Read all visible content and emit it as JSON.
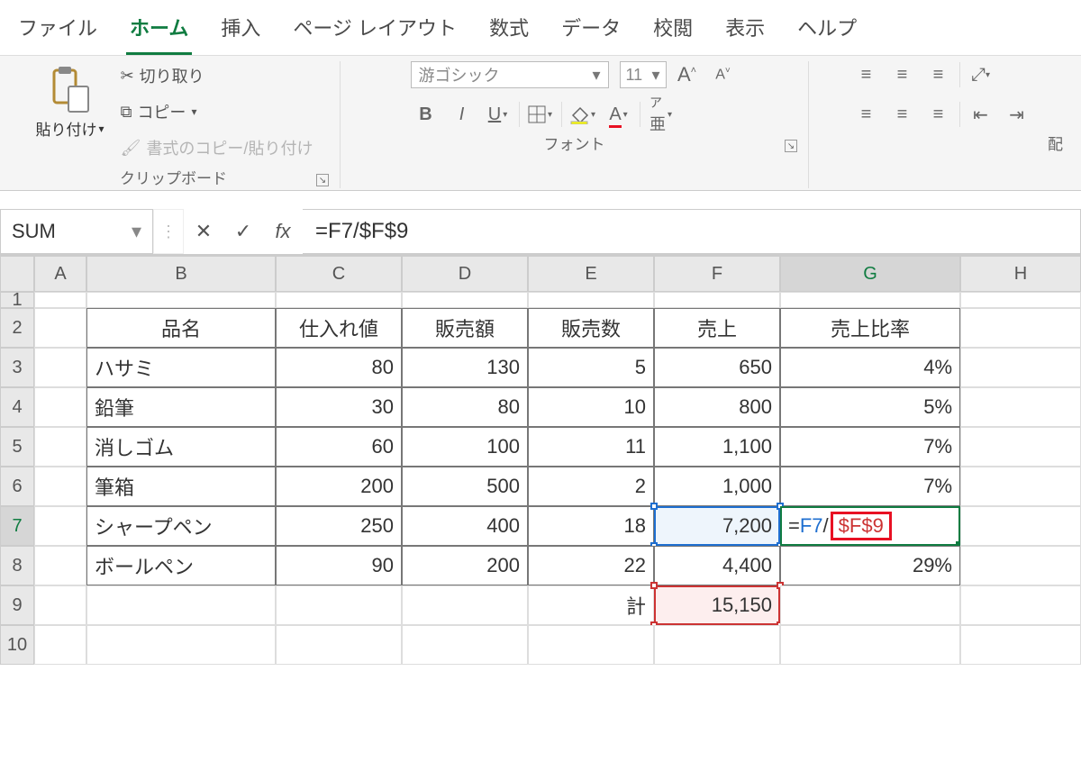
{
  "tabs": {
    "file": "ファイル",
    "home": "ホーム",
    "insert": "挿入",
    "page_layout": "ページ レイアウト",
    "formulas": "数式",
    "data": "データ",
    "review": "校閲",
    "view": "表示",
    "help": "ヘルプ"
  },
  "ribbon": {
    "clipboard": {
      "paste": "貼り付け",
      "cut": "切り取り",
      "copy": "コピー",
      "format_painter": "書式のコピー/貼り付け",
      "label": "クリップボード"
    },
    "font": {
      "name": "游ゴシック",
      "size": "11",
      "label": "フォント"
    },
    "alignment": {
      "label_partial": "配"
    }
  },
  "formula_bar": {
    "name_box": "SUM",
    "formula": "=F7/$F$9"
  },
  "columns": [
    "A",
    "B",
    "C",
    "D",
    "E",
    "F",
    "G",
    "H"
  ],
  "rows": [
    "1",
    "2",
    "3",
    "4",
    "5",
    "6",
    "7",
    "8",
    "9",
    "10"
  ],
  "table": {
    "headers": {
      "b": "品名",
      "c": "仕入れ値",
      "d": "販売額",
      "e": "販売数",
      "f": "売上",
      "g": "売上比率"
    },
    "data": [
      {
        "b": "ハサミ",
        "c": "80",
        "d": "130",
        "e": "5",
        "f": "650",
        "g": "4%"
      },
      {
        "b": "鉛筆",
        "c": "30",
        "d": "80",
        "e": "10",
        "f": "800",
        "g": "5%"
      },
      {
        "b": "消しゴム",
        "c": "60",
        "d": "100",
        "e": "11",
        "f": "1,100",
        "g": "7%"
      },
      {
        "b": "筆箱",
        "c": "200",
        "d": "500",
        "e": "2",
        "f": "1,000",
        "g": "7%"
      },
      {
        "b": "シャープペン",
        "c": "250",
        "d": "400",
        "e": "18",
        "f": "7,200",
        "g_edit": {
          "prefix": "=",
          "ref1": "F7",
          "mid": "/",
          "ref2": "$F$9"
        }
      },
      {
        "b": "ボールペン",
        "c": "90",
        "d": "200",
        "e": "22",
        "f": "4,400",
        "g": "29%"
      }
    ],
    "total_label": "計",
    "total_value": "15,150"
  }
}
